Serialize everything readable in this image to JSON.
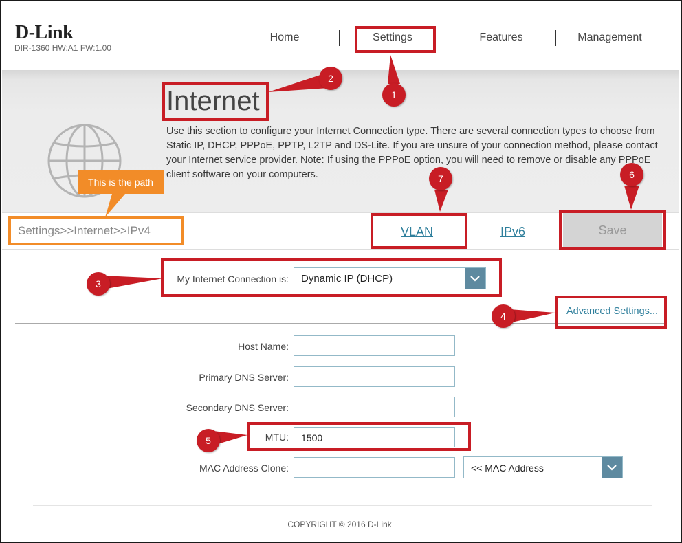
{
  "header": {
    "brand": "D-Link",
    "model_info": "DIR-1360 HW:A1 FW:1.00",
    "nav": [
      "Home",
      "Settings",
      "Features",
      "Management"
    ]
  },
  "page": {
    "title": "Internet",
    "description": "Use this section to configure your Internet Connection type. There are several connection types to choose from Static IP, DHCP, PPPoE, PPTP, L2TP and DS-Lite. If you are unsure of your connection method, please contact your Internet service provider. Note: If using the PPPoE option, you will need to remove or disable any PPPoE client software on your computers."
  },
  "pathbar": {
    "path": "Settings>>Internet>>IPv4",
    "vlan_link": "VLAN",
    "ipv6_link": "IPv6",
    "save_label": "Save"
  },
  "form": {
    "connection_label": "My Internet Connection is:",
    "connection_value": "Dynamic IP (DHCP)",
    "advanced_link": "Advanced Settings...",
    "host_name_label": "Host Name:",
    "host_name_value": "",
    "primary_dns_label": "Primary DNS Server:",
    "primary_dns_value": "",
    "secondary_dns_label": "Secondary DNS Server:",
    "secondary_dns_value": "",
    "mtu_label": "MTU:",
    "mtu_value": "1500",
    "mac_clone_label": "MAC Address Clone:",
    "mac_clone_value": "",
    "mac_select_value": "<< MAC Address"
  },
  "footer": {
    "copyright": "COPYRIGHT © 2016 D-Link"
  },
  "annotations": {
    "callout_text": "This is the path",
    "badges": [
      "1",
      "2",
      "3",
      "4",
      "5",
      "6",
      "7"
    ],
    "colors": {
      "red": "#c81d25",
      "orange": "#f28c28",
      "accent": "#2f7f9c"
    }
  }
}
